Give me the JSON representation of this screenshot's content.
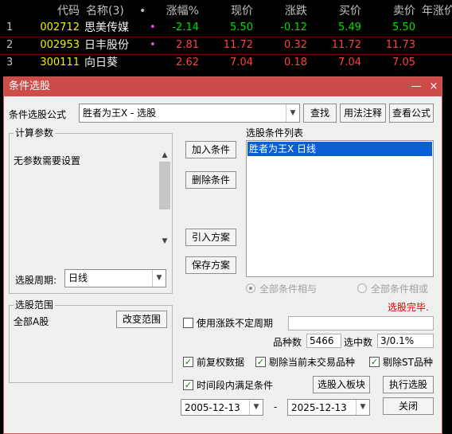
{
  "grid": {
    "headers": {
      "code": "代码",
      "name": "名称(3)",
      "dot": "•",
      "pct": "涨幅%",
      "price": "现价",
      "chg": "涨跌",
      "buy": "买价",
      "sell": "卖价",
      "extra": "年涨价"
    },
    "rows": [
      {
        "idx": "1",
        "code": "002712",
        "name": "思美传媒",
        "mark": "•",
        "pct": "-2.14",
        "price": "5.50",
        "chg": "-0.12",
        "buy": "5.49",
        "sell": "5.50"
      },
      {
        "idx": "2",
        "code": "002953",
        "name": "日丰股份",
        "mark": "•",
        "pct": "2.81",
        "price": "11.72",
        "chg": "0.32",
        "buy": "11.72",
        "sell": "11.73"
      },
      {
        "idx": "3",
        "code": "300111",
        "name": "向日葵",
        "mark": "",
        "pct": "2.62",
        "price": "7.04",
        "chg": "0.18",
        "buy": "7.04",
        "sell": "7.05"
      }
    ]
  },
  "dialog": {
    "title": "条件选股",
    "min_icon": "—",
    "max_icon": "□",
    "close_icon": "×",
    "formula_label": "条件选股公式",
    "formula_value": "胜者为王X  -  选股",
    "find_btn": "查找",
    "usage_btn": "用法注释",
    "view_btn": "查看公式",
    "params_group": "计算参数",
    "params_text": "无参数需要设置",
    "period_label": "选股周期:",
    "period_value": "日线",
    "add_btn": "加入条件",
    "del_btn": "删除条件",
    "import_btn": "引入方案",
    "save_btn": "保存方案",
    "cond_list_label": "选股条件列表",
    "cond_items": [
      "胜者为王X  日线"
    ],
    "radio_and": "全部条件相与",
    "radio_or": "全部条件相或",
    "status": "选股完毕.",
    "range_group": "选股范围",
    "range_value": "全部A股",
    "change_range_btn": "改变范围",
    "var_period_label": "使用涨跌不定周期",
    "count_label": "品种数",
    "count_value": "5466",
    "selected_label": "选中数",
    "selected_value": "3/0.1%",
    "fq_label": "前复权数据",
    "exclude_label": "剔除当前未交易品种",
    "st_label": "剔除ST品种",
    "time_label": "时间段内满足条件",
    "to_block_btn": "选股入板块",
    "exec_btn": "执行选股",
    "date_from": "2005-12-13",
    "date_sep": "-",
    "date_to": "2025-12-13",
    "close_btn": "关闭"
  },
  "colors": {
    "up": "#ff4040",
    "down": "#00e000",
    "code": "#f0f000",
    "title_bar": "#cd4c4a",
    "selection": "#0a5fd7",
    "status": "#e00000"
  }
}
